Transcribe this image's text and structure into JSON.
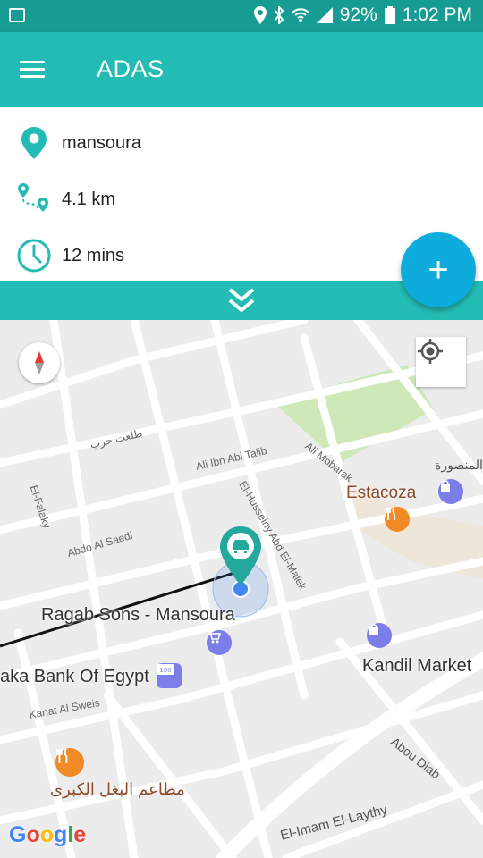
{
  "status_bar": {
    "battery": "92%",
    "time": "1:02 PM",
    "icons": [
      "image-icon",
      "location-icon",
      "bluetooth-icon",
      "wifi-icon",
      "signal-icon",
      "battery-icon"
    ]
  },
  "app_bar": {
    "title": "ADAS",
    "menu_icon": "hamburger-menu-icon"
  },
  "route_info": {
    "destination": "mansoura",
    "distance": "4.1 km",
    "duration": "12 mins",
    "icons": [
      "location-pin-icon",
      "route-icon",
      "clock-icon"
    ]
  },
  "collapse_icon": "double-chevron-down-icon",
  "fab": {
    "label": "+",
    "icon": "plus-icon"
  },
  "map": {
    "labels": {
      "estacoza": "Estacoza",
      "mansoura_ar": "المنصورة",
      "ragab_sons": "Ragab Sons - Mansoura",
      "kandil_market": "Kandil Market",
      "bank": "aka Bank Of Egypt",
      "restaurant_ar": "مطاعم البغل الكبرى",
      "ali_ibn_abi_talib": "Ali Ibn Abi Talib",
      "ali_mobarak": "Ali Mobarak",
      "el_husseiny": "El-Husseiny Abd El-Malek",
      "abdo_al_saedi": "Abdo Al Saedi",
      "el_falaky": "El-Falaky",
      "kanat_al_sweis": "Kanat Al Sweis",
      "abou_diab": "Abou Diab",
      "el_imam": "El-Imam El-Laythy",
      "talaat_harb_ar": "طلعت حرب"
    },
    "attribution": "Google",
    "colors": {
      "accent": "#23bcb4",
      "accent_dark": "#179c94",
      "fab": "#0eacdc",
      "park": "#c8e6b4",
      "poi_food": "#f08a24",
      "poi_shop": "#7b7ee8",
      "user_dot": "#4285f4"
    }
  }
}
